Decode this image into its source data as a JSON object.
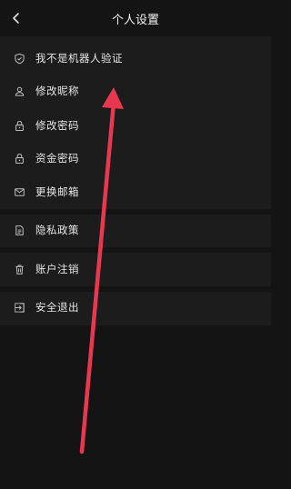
{
  "header": {
    "title": "个人设置",
    "back_icon": "chevron-left-icon"
  },
  "menu": [
    {
      "id": "robot-verify",
      "label": "我不是机器人验证",
      "icon": "shield-check-icon"
    },
    {
      "id": "nickname",
      "label": "修改昵称",
      "icon": "user-icon"
    },
    {
      "id": "password",
      "label": "修改密码",
      "icon": "lock-icon"
    },
    {
      "id": "fund-password",
      "label": "资金密码",
      "icon": "lock-icon"
    },
    {
      "id": "email",
      "label": "更换邮箱",
      "icon": "mail-icon"
    },
    {
      "id": "privacy",
      "label": "隐私政策",
      "icon": "document-icon"
    },
    {
      "id": "cancel-account",
      "label": "账户注销",
      "icon": "trash-icon"
    },
    {
      "id": "logout",
      "label": "安全退出",
      "icon": "logout-icon"
    }
  ],
  "colors": {
    "background": "#141414",
    "panel": "#1c1c1c",
    "arrow": "#e8384f"
  }
}
